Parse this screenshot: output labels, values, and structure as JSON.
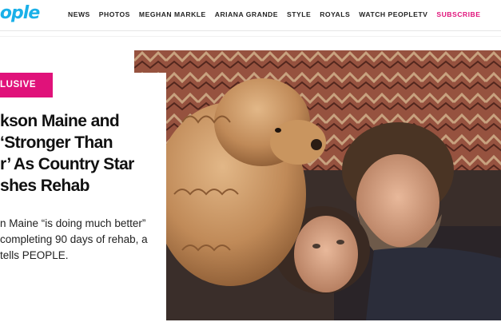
{
  "header": {
    "logo": "eople",
    "nav": [
      "NEWS",
      "PHOTOS",
      "MEGHAN MARKLE",
      "ARIANA GRANDE",
      "STYLE",
      "ROYALS",
      "WATCH PEOPLETV",
      "SUBSCRIBE"
    ],
    "subscribe_color": "#e0127a",
    "logo_color": "#1ab0e8"
  },
  "article": {
    "badge": "LUSIVE",
    "headline_lines": [
      "kson Maine and",
      "‘Stronger Than",
      "r’ As Country Star",
      "shes Rehab"
    ],
    "dek_lines": [
      "n Maine “is doing much better”",
      "completing 90 days of rehab, a",
      "tells PEOPLE."
    ]
  },
  "hero_image": {
    "subject": "man and woman lying together with a fluffy dog",
    "icon": "photo"
  }
}
